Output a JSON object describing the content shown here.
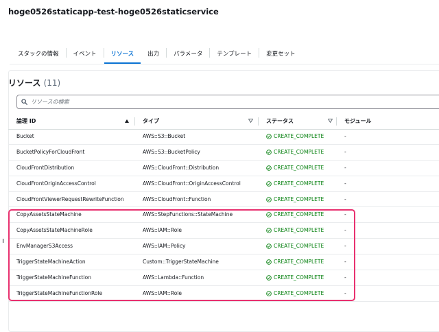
{
  "stack": {
    "title": "hoge0526staticapp-test-hoge0526staticservice"
  },
  "tabs": [
    {
      "label": "スタックの情報",
      "active": false
    },
    {
      "label": "イベント",
      "active": false
    },
    {
      "label": "リソース",
      "active": true
    },
    {
      "label": "出力",
      "active": false
    },
    {
      "label": "パラメータ",
      "active": false
    },
    {
      "label": "テンプレート",
      "active": false
    },
    {
      "label": "変更セット",
      "active": false
    }
  ],
  "resources": {
    "title": "リソース",
    "count": "(11)",
    "search_placeholder": "リソースの検索",
    "columns": {
      "logical_id": "論理 ID",
      "type": "タイプ",
      "status": "ステータス",
      "module": "モジュール"
    },
    "rows": [
      {
        "logical_id": "Bucket",
        "type": "AWS::S3::Bucket",
        "status": "CREATE_COMPLETE",
        "module": "-"
      },
      {
        "logical_id": "BucketPolicyForCloudFront",
        "type": "AWS::S3::BucketPolicy",
        "status": "CREATE_COMPLETE",
        "module": "-"
      },
      {
        "logical_id": "CloudFrontDistribution",
        "type": "AWS::CloudFront::Distribution",
        "status": "CREATE_COMPLETE",
        "module": "-"
      },
      {
        "logical_id": "CloudFrontOriginAccessControl",
        "type": "AWS::CloudFront::OriginAccessControl",
        "status": "CREATE_COMPLETE",
        "module": "-"
      },
      {
        "logical_id": "CloudFrontViewerRequestRewriteFunction",
        "type": "AWS::CloudFront::Function",
        "status": "CREATE_COMPLETE",
        "module": "-"
      },
      {
        "logical_id": "CopyAssetsStateMachine",
        "type": "AWS::StepFunctions::StateMachine",
        "status": "CREATE_COMPLETE",
        "module": "-"
      },
      {
        "logical_id": "CopyAssetsStateMachineRole",
        "type": "AWS::IAM::Role",
        "status": "CREATE_COMPLETE",
        "module": "-"
      },
      {
        "logical_id": "EnvManagerS3Access",
        "type": "AWS::IAM::Policy",
        "status": "CREATE_COMPLETE",
        "module": "-"
      },
      {
        "logical_id": "TriggerStateMachineAction",
        "type": "Custom::TriggerStateMachine",
        "status": "CREATE_COMPLETE",
        "module": "-"
      },
      {
        "logical_id": "TriggerStateMachineFunction",
        "type": "AWS::Lambda::Function",
        "status": "CREATE_COMPLETE",
        "module": "-"
      },
      {
        "logical_id": "TriggerStateMachineFunctionRole",
        "type": "AWS::IAM::Role",
        "status": "CREATE_COMPLETE",
        "module": "-"
      }
    ]
  },
  "colors": {
    "accent": "#0972d3",
    "success": "#037f0c",
    "highlight": "#e8316f"
  },
  "icons": {
    "search": "search-icon",
    "status_ok": "check-circle-icon",
    "sort_asc": "sort-ascending-icon",
    "sort_desc": "sort-descending-icon"
  }
}
